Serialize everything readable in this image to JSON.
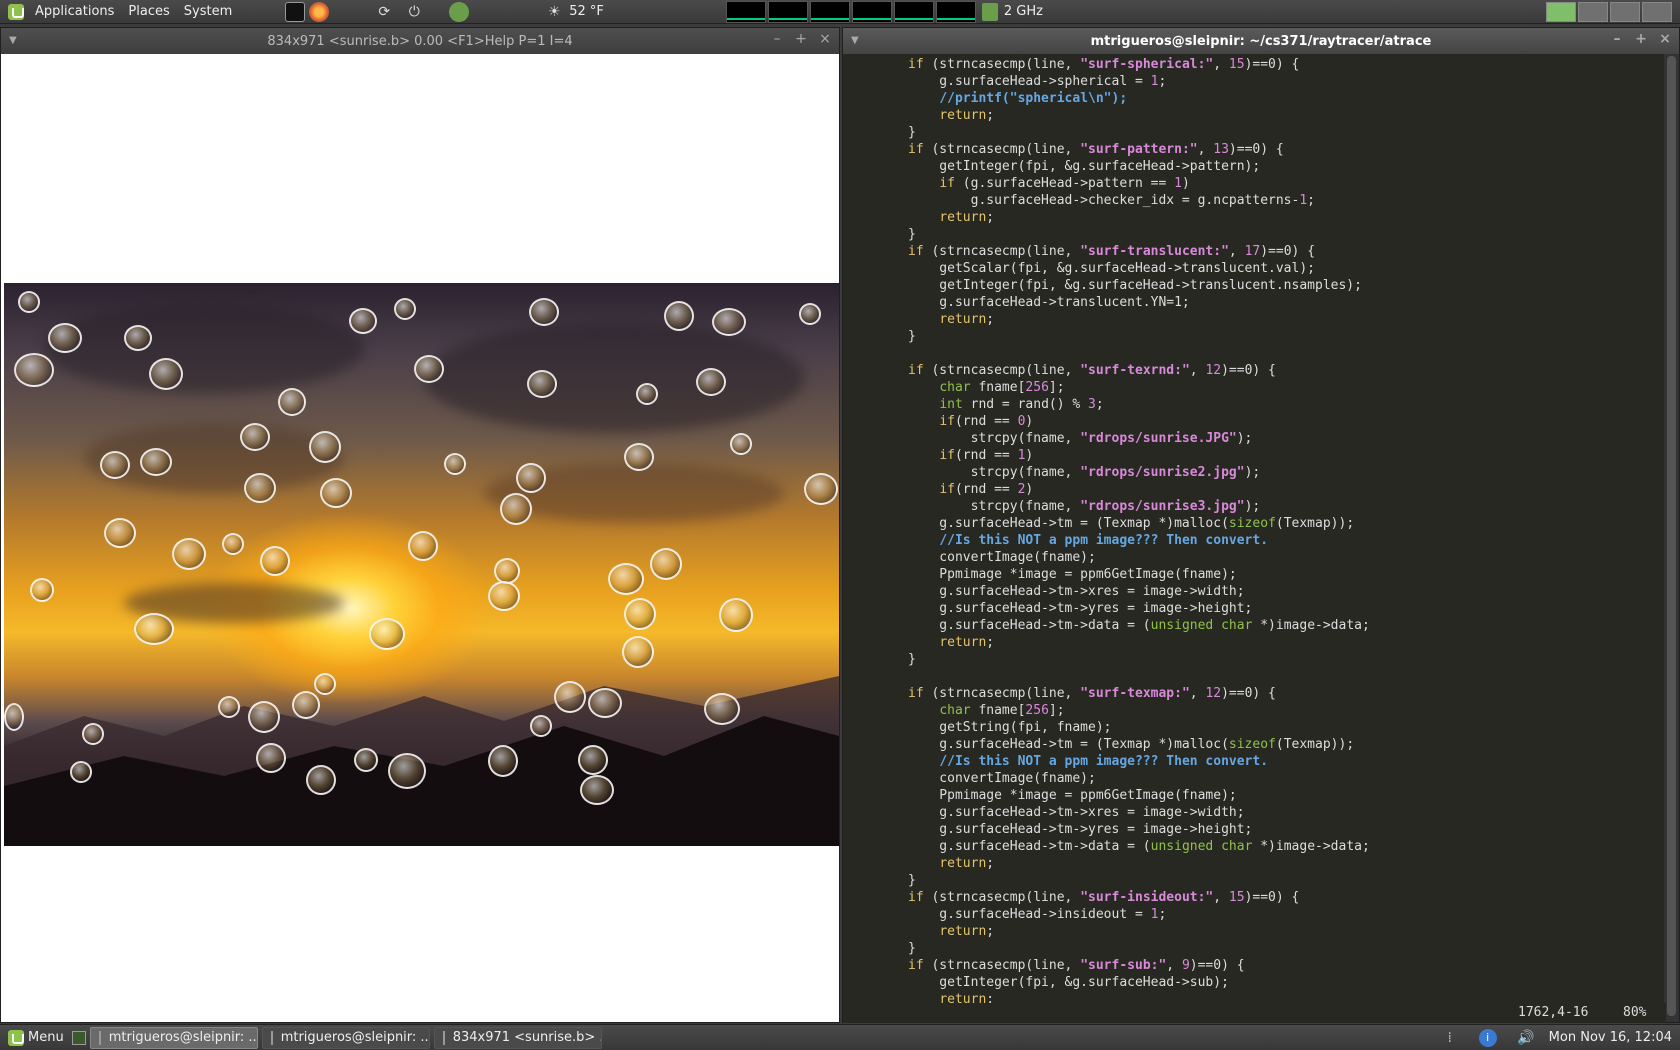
{
  "top_panel": {
    "menus": [
      "Applications",
      "Places",
      "System"
    ],
    "weather": "52 °F",
    "cpu_freq": "2 GHz"
  },
  "viewer": {
    "title": "834x971 <sunrise.b>  0.00 <F1>Help P=1 I=4"
  },
  "terminal": {
    "title": "mtrigueros@sleipnir: ~/cs371/raytracer/atrace",
    "status_pos": "1762,4-16",
    "status_pct": "80%"
  },
  "code_lines": [
    "if (strncasecmp(line, \"surf-spherical:\", 15)==0) {",
    "    g.surfaceHead->spherical = 1;",
    "    //printf(\"spherical\\n\");",
    "    return;",
    "}",
    "if (strncasecmp(line, \"surf-pattern:\", 13)==0) {",
    "    getInteger(fpi, &g.surfaceHead->pattern);",
    "    if (g.surfaceHead->pattern == 1)",
    "        g.surfaceHead->checker_idx = g.ncpatterns-1;",
    "    return;",
    "}",
    "if (strncasecmp(line, \"surf-translucent:\", 17)==0) {",
    "    getScalar(fpi, &g.surfaceHead->translucent.val);",
    "    getInteger(fpi, &g.surfaceHead->translucent.nsamples);",
    "    g.surfaceHead->translucent.YN=1;",
    "    return;",
    "}",
    "",
    "if (strncasecmp(line, \"surf-texrnd:\", 12)==0) {",
    "    char fname[256];",
    "    int rnd = rand() % 3;",
    "    if(rnd == 0)",
    "        strcpy(fname, \"rdrops/sunrise.JPG\");",
    "    if(rnd == 1)",
    "        strcpy(fname, \"rdrops/sunrise2.jpg\");",
    "    if(rnd == 2)",
    "        strcpy(fname, \"rdrops/sunrise3.jpg\");",
    "    g.surfaceHead->tm = (Texmap *)malloc(sizeof(Texmap));",
    "    //Is this NOT a ppm image??? Then convert.",
    "    convertImage(fname);",
    "    Ppmimage *image = ppm6GetImage(fname);",
    "    g.surfaceHead->tm->xres = image->width;",
    "    g.surfaceHead->tm->yres = image->height;",
    "    g.surfaceHead->tm->data = (unsigned char *)image->data;",
    "    return;",
    "}",
    "",
    "if (strncasecmp(line, \"surf-texmap:\", 12)==0) {",
    "    char fname[256];",
    "    getString(fpi, fname);",
    "    g.surfaceHead->tm = (Texmap *)malloc(sizeof(Texmap));",
    "    //Is this NOT a ppm image??? Then convert.",
    "    convertImage(fname);",
    "    Ppmimage *image = ppm6GetImage(fname);",
    "    g.surfaceHead->tm->xres = image->width;",
    "    g.surfaceHead->tm->yres = image->height;",
    "    g.surfaceHead->tm->data = (unsigned char *)image->data;",
    "    return;",
    "}",
    "if (strncasecmp(line, \"surf-insideout:\", 15)==0) {",
    "    g.surfaceHead->insideout = 1;",
    "    return;",
    "}",
    "if (strncasecmp(line, \"surf-sub:\", 9)==0) {",
    "    getInteger(fpi, &g.surfaceHead->sub);",
    "    return;"
  ],
  "bottom_panel": {
    "menu_label": "Menu",
    "tasks": [
      "mtrigueros@sleipnir: ...",
      "mtrigueros@sleipnir: ...",
      "834x971 <sunrise.b>  ..."
    ],
    "clock": "Mon Nov 16, 12:04"
  },
  "colors": {
    "accent": "#8fc24a",
    "terminal_bg": "#272822"
  }
}
